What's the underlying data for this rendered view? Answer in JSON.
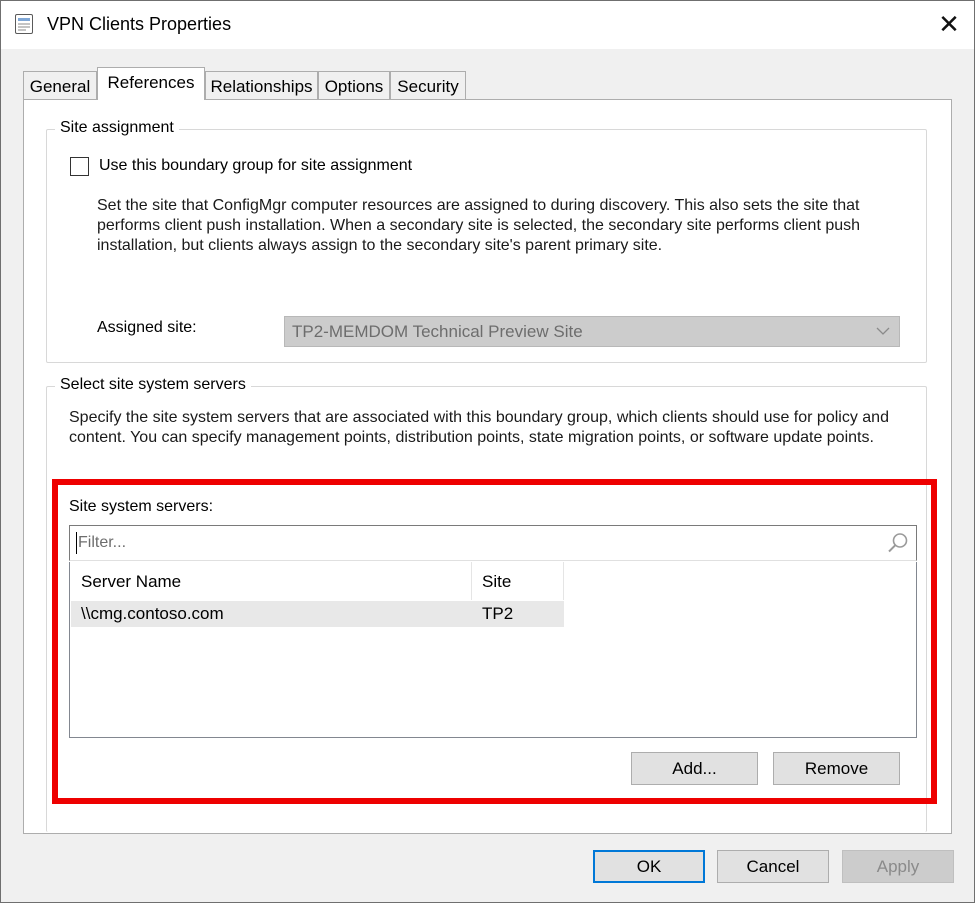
{
  "window": {
    "title": "VPN Clients Properties",
    "close_glyph": "✕",
    "app_icon": "properties-sheet-icon",
    "close_icon": "close-icon"
  },
  "tabs": [
    {
      "label": "General",
      "active": false
    },
    {
      "label": "References",
      "active": true
    },
    {
      "label": "Relationships",
      "active": false
    },
    {
      "label": "Options",
      "active": false
    },
    {
      "label": "Security",
      "active": false
    }
  ],
  "site_assignment": {
    "legend": "Site assignment",
    "checkbox_label": "Use this boundary group for site assignment",
    "checked": false,
    "description_lines": [
      "Set the site that ConfigMgr computer resources are assigned to during discovery. This also sets the site that",
      "performs client push installation. When a secondary site is selected, the secondary site performs client push",
      "installation, but clients always assign to the secondary site's parent primary site."
    ],
    "assigned_site_label": "Assigned site:",
    "assigned_site_value": "TP2-MEMDOM Technical Preview Site",
    "assigned_site_enabled": false
  },
  "site_servers": {
    "legend": "Select site system servers",
    "description_lines": [
      "Specify the site system servers that are associated with this boundary group, which clients should use for policy and",
      "content. You can specify management points, distribution points, state migration points, or software update points."
    ],
    "list_label": "Site system servers:",
    "filter_placeholder": "Filter...",
    "filter_value": "",
    "search_icon": "search-icon",
    "columns": [
      "Server Name",
      "Site"
    ],
    "rows": [
      {
        "server": "\\\\cmg.contoso.com",
        "site": "TP2"
      }
    ],
    "add_label": "Add...",
    "remove_label": "Remove"
  },
  "annotation": {
    "highlight_color": "#ee0000"
  },
  "footer": {
    "ok_label": "OK",
    "cancel_label": "Cancel",
    "apply_label": "Apply",
    "apply_enabled": false
  }
}
